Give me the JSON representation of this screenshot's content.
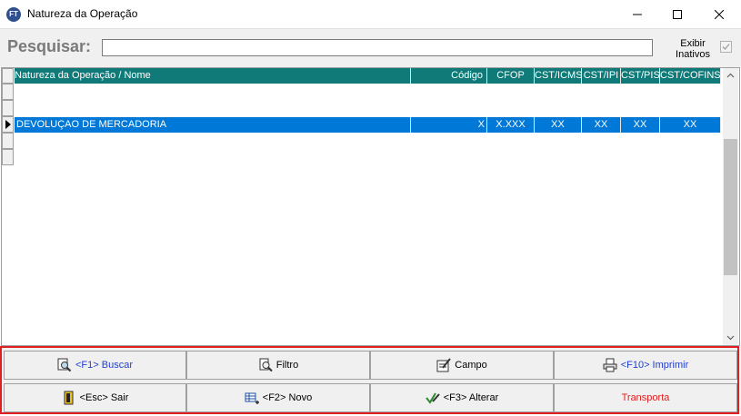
{
  "window": {
    "app_icon_text": "FT",
    "title": "Natureza da Operação"
  },
  "search": {
    "label": "Pesquisar:",
    "value": "",
    "exibir_inativos_label": "Exibir Inativos",
    "exibir_inativos_checked": true
  },
  "grid": {
    "columns": [
      "Natureza da Operação / Nome",
      "Código",
      "CFOP",
      "CST/ICMS",
      "CST/IPI",
      "CST/PIS",
      "CST/COFINS"
    ],
    "rows": [
      {
        "nome": "DEVOLUÇAO DE MERCADORIA",
        "codigo": "X",
        "cfop": "X.XXX",
        "cst_icms": "XX",
        "cst_ipi": "XX",
        "cst_pis": "XX",
        "cst_cofins": "XX",
        "selected": true
      }
    ]
  },
  "buttons": {
    "buscar": "<F1> Buscar",
    "filtro": "Filtro",
    "campo": "Campo",
    "imprimir": "<F10> Imprimir",
    "sair": "<Esc> Sair",
    "novo": "<F2> Novo",
    "alterar": "<F3> Alterar",
    "transporta": "Transporta"
  },
  "colors": {
    "header_bg": "#0f7a78",
    "selection_bg": "#0078d7",
    "panel_border": "#e02020",
    "link_blue": "#1f3fd0"
  }
}
